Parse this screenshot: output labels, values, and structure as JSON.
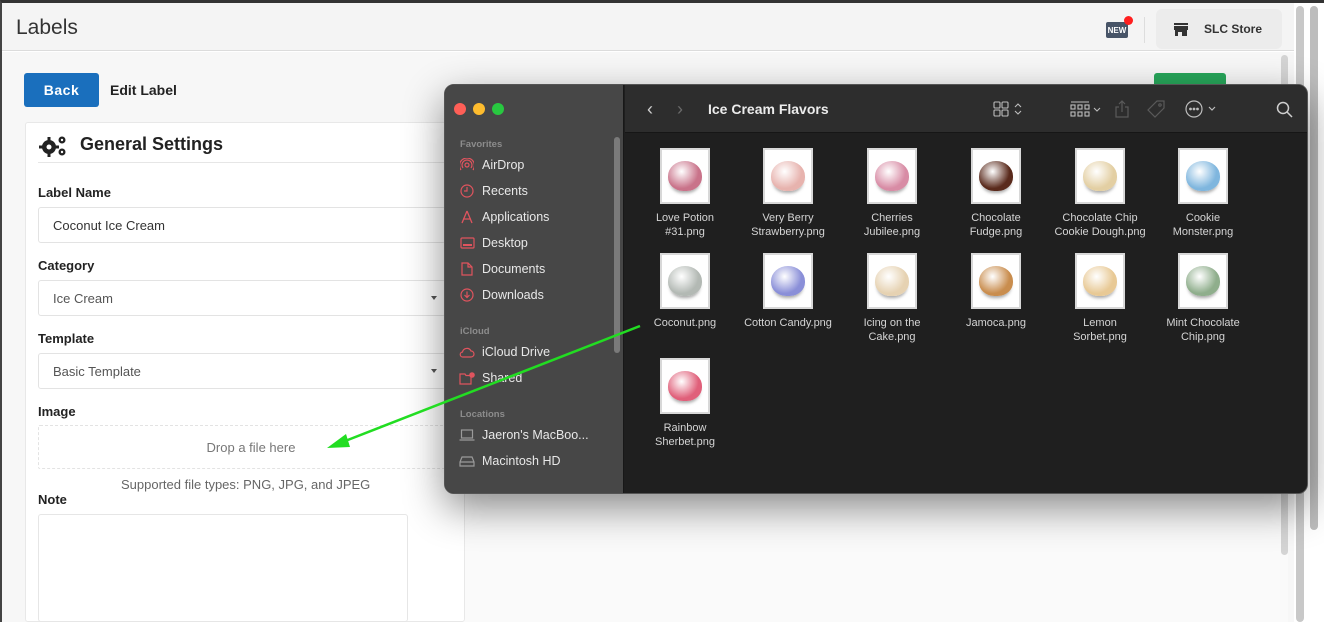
{
  "app": {
    "title": "Labels",
    "new_badge": "NEW",
    "store_label": "SLC Store"
  },
  "toolbar": {
    "back_label": "Back",
    "page_heading": "Edit Label"
  },
  "form": {
    "section_title": "General Settings",
    "label_name": {
      "label": "Label Name",
      "value": "Coconut Ice Cream"
    },
    "category": {
      "label": "Category",
      "value": "Ice Cream"
    },
    "template": {
      "label": "Template",
      "value": "Basic Template"
    },
    "image": {
      "label": "Image",
      "drop_text": "Drop a file here",
      "supported": "Supported file types: PNG, JPG, and JPEG"
    },
    "note": {
      "label": "Note",
      "value": ""
    }
  },
  "finder": {
    "folder_title": "Ice Cream Flavors",
    "sidebar": {
      "sections": [
        {
          "title": "Favorites",
          "items": [
            {
              "label": "AirDrop",
              "icon": "airdrop-icon"
            },
            {
              "label": "Recents",
              "icon": "clock-icon"
            },
            {
              "label": "Applications",
              "icon": "applications-icon"
            },
            {
              "label": "Desktop",
              "icon": "desktop-icon"
            },
            {
              "label": "Documents",
              "icon": "document-icon"
            },
            {
              "label": "Downloads",
              "icon": "download-icon"
            }
          ]
        },
        {
          "title": "iCloud",
          "items": [
            {
              "label": "iCloud Drive",
              "icon": "cloud-icon"
            },
            {
              "label": "Shared",
              "icon": "shared-folder-icon"
            }
          ]
        },
        {
          "title": "Locations",
          "items": [
            {
              "label": "Jaeron's MacBoo...",
              "icon": "laptop-icon"
            },
            {
              "label": "Macintosh HD",
              "icon": "disk-icon"
            }
          ]
        }
      ]
    },
    "files": [
      {
        "name": "Love Potion\n#31.png",
        "color": "#c9738a"
      },
      {
        "name": "Very Berry\nStrawberry.png",
        "color": "#e7b3ae"
      },
      {
        "name": "Cherries\nJubilee.png",
        "color": "#d88ca5"
      },
      {
        "name": "Chocolate\nFudge.png",
        "color": "#5a2a1c"
      },
      {
        "name": "Chocolate Chip\nCookie Dough.png",
        "color": "#e3cfa3"
      },
      {
        "name": "Cookie\nMonster.png",
        "color": "#7fb6de"
      },
      {
        "name": "Coconut.png",
        "color": "#b3b9b4"
      },
      {
        "name": "Cotton Candy.png",
        "color": "#8a8fd8"
      },
      {
        "name": "Icing on the\nCake.png",
        "color": "#e6d2b2"
      },
      {
        "name": "Jamoca.png",
        "color": "#c98d4e"
      },
      {
        "name": "Lemon\nSorbet.png",
        "color": "#e8c995"
      },
      {
        "name": "Mint Chocolate\nChip.png",
        "color": "#8fae8c"
      },
      {
        "name": "Rainbow\nSherbet.png",
        "color": "#e0607a"
      }
    ]
  },
  "annotation": {
    "arrow_color": "#22dd22"
  }
}
